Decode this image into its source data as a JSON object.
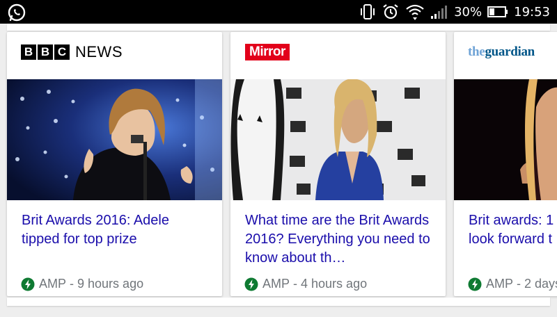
{
  "status_bar": {
    "battery_percent": "30%",
    "time": "19:53",
    "icons": [
      "whatsapp-icon",
      "vibrate-icon",
      "alarm-icon",
      "wifi-icon",
      "signal-icon",
      "battery-icon"
    ]
  },
  "cards": [
    {
      "source": "BBC NEWS",
      "source_letters": [
        "B",
        "B",
        "C"
      ],
      "source_word": "NEWS",
      "title": "Brit Awards 2016: Adele tipped for top prize",
      "amp": "AMP",
      "separator": "-",
      "time": "9 hours ago"
    },
    {
      "source": "Mirror",
      "title": "What time are the Brit Awards 2016? Everything you need to know about th…",
      "amp": "AMP",
      "separator": "-",
      "time": "4 hours ago"
    },
    {
      "source_the": "the",
      "source_name": "guardian",
      "title": "Brit awards: 1 look forward t",
      "amp": "AMP",
      "separator": "-",
      "time": "2 days"
    }
  ],
  "colors": {
    "title_link": "#1a0dab",
    "amp_green": "#0e7a32",
    "meta_gray": "#70757a",
    "mirror_red": "#e2001a",
    "guardian_blue": "#005689"
  }
}
